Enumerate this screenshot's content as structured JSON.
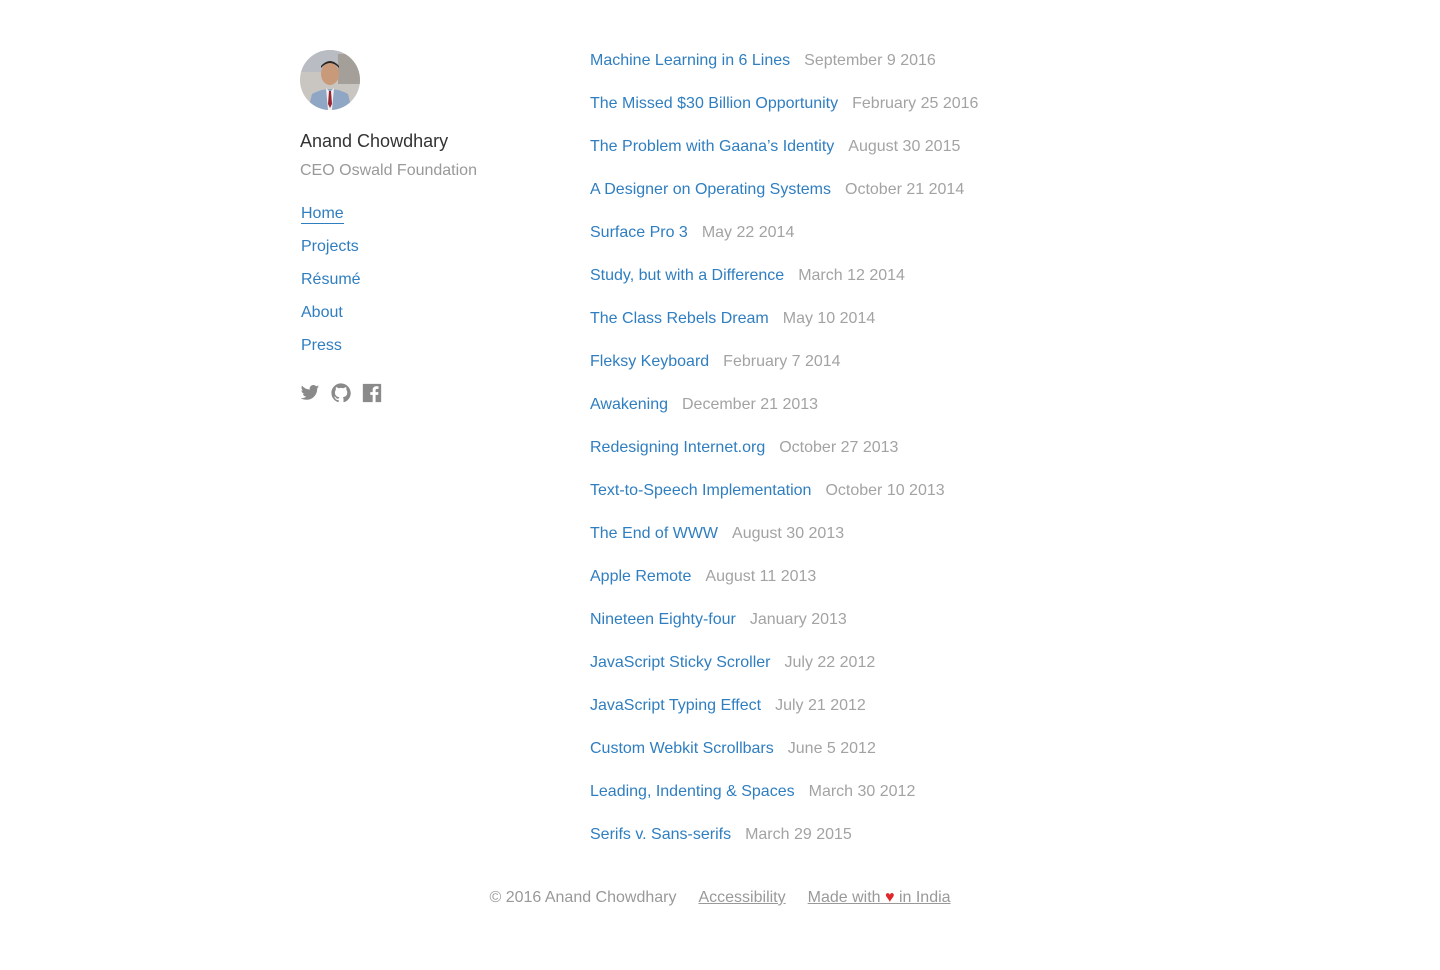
{
  "profile": {
    "name": "Anand Chowdhary",
    "role": "CEO Oswald Foundation"
  },
  "nav": [
    {
      "label": "Home",
      "active": true
    },
    {
      "label": "Projects"
    },
    {
      "label": "Résumé"
    },
    {
      "label": "About"
    },
    {
      "label": "Press"
    }
  ],
  "social": [
    "twitter-icon",
    "github-icon",
    "facebook-icon"
  ],
  "colors": {
    "link": "#2f7ec0",
    "muted": "#999999",
    "heart": "#e0262b"
  },
  "posts": [
    {
      "title": "Machine Learning in 6 Lines",
      "date": "September 9 2016"
    },
    {
      "title": "The Missed $30 Billion Opportunity",
      "date": "February 25 2016"
    },
    {
      "title": "The Problem with Gaana’s Identity",
      "date": "August 30 2015"
    },
    {
      "title": "A Designer on Operating Systems",
      "date": "October 21 2014"
    },
    {
      "title": "Surface Pro 3",
      "date": "May 22 2014"
    },
    {
      "title": "Study, but with a Difference",
      "date": "March 12 2014"
    },
    {
      "title": "The Class Rebels Dream",
      "date": "May 10 2014"
    },
    {
      "title": "Fleksy Keyboard",
      "date": "February 7 2014"
    },
    {
      "title": "Awakening",
      "date": "December 21 2013"
    },
    {
      "title": "Redesigning Internet.org",
      "date": "October 27 2013"
    },
    {
      "title": "Text-to-Speech Implementation",
      "date": "October 10 2013"
    },
    {
      "title": "The End of WWW",
      "date": "August 30 2013"
    },
    {
      "title": "Apple Remote",
      "date": "August 11 2013"
    },
    {
      "title": "Nineteen Eighty-four",
      "date": "January 2013"
    },
    {
      "title": "JavaScript Sticky Scroller",
      "date": "July 22 2012"
    },
    {
      "title": "JavaScript Typing Effect",
      "date": "July 21 2012"
    },
    {
      "title": "Custom Webkit Scrollbars",
      "date": "June 5 2012"
    },
    {
      "title": "Leading, Indenting & Spaces",
      "date": "March 30 2012"
    },
    {
      "title": "Serifs v. Sans-serifs",
      "date": "March 29 2015"
    }
  ],
  "footer": {
    "copyright": "© 2016 Anand Chowdhary",
    "accessibility": "Accessibility",
    "made_with_prefix": "Made with ",
    "heart": "♥",
    "made_with_suffix": " in India"
  }
}
